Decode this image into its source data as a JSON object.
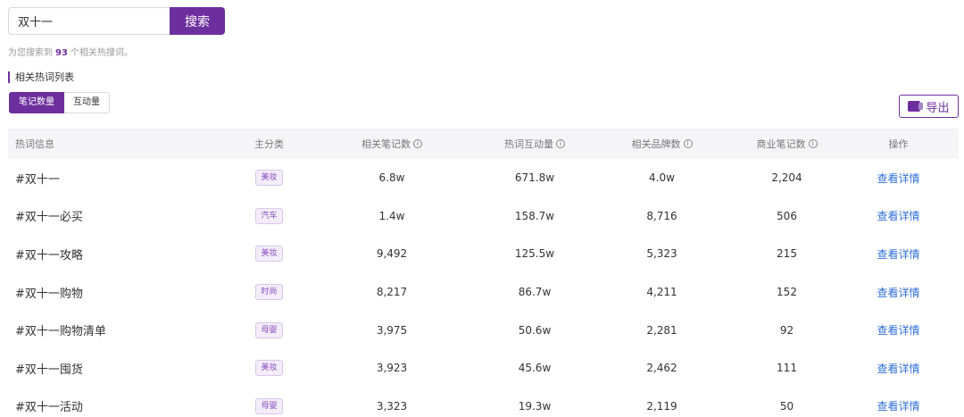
{
  "search": {
    "value": "双十一",
    "button_label": "搜索"
  },
  "summary": {
    "prefix": "为您搜索到",
    "count": "93",
    "suffix": "个相关热搜词。"
  },
  "section_title": "相关热词列表",
  "toggles": [
    {
      "label": "笔记数量",
      "active": true
    },
    {
      "label": "互动量",
      "active": false
    }
  ],
  "export_label": "导出",
  "table": {
    "headers": {
      "keyword": "热词信息",
      "category": "主分类",
      "notes": "相关笔记数",
      "interactions": "热词互动量",
      "brands": "相关品牌数",
      "business_notes": "商业笔记数",
      "action": "操作"
    },
    "rows": [
      {
        "keyword": "#双十一",
        "category": "美妆",
        "notes": "6.8w",
        "interactions": "671.8w",
        "brands": "4.0w",
        "business_notes": "2,204",
        "action": "查看详情"
      },
      {
        "keyword": "#双十一必买",
        "category": "汽车",
        "notes": "1.4w",
        "interactions": "158.7w",
        "brands": "8,716",
        "business_notes": "506",
        "action": "查看详情"
      },
      {
        "keyword": "#双十一攻略",
        "category": "美妆",
        "notes": "9,492",
        "interactions": "125.5w",
        "brands": "5,323",
        "business_notes": "215",
        "action": "查看详情"
      },
      {
        "keyword": "#双十一购物",
        "category": "时尚",
        "notes": "8,217",
        "interactions": "86.7w",
        "brands": "4,211",
        "business_notes": "152",
        "action": "查看详情"
      },
      {
        "keyword": "#双十一购物清单",
        "category": "母婴",
        "notes": "3,975",
        "interactions": "50.6w",
        "brands": "2,281",
        "business_notes": "92",
        "action": "查看详情"
      },
      {
        "keyword": "#双十一囤货",
        "category": "美妆",
        "notes": "3,923",
        "interactions": "45.6w",
        "brands": "2,462",
        "business_notes": "111",
        "action": "查看详情"
      },
      {
        "keyword": "#双十一活动",
        "category": "母婴",
        "notes": "3,323",
        "interactions": "19.3w",
        "brands": "2,119",
        "business_notes": "50",
        "action": "查看详情"
      }
    ]
  },
  "colors": {
    "accent": "#6e2f9e",
    "link": "#2f6fd6",
    "header_bg": "#f5f5f7"
  },
  "icons": {
    "export": "excel-icon",
    "info": "info-icon"
  }
}
